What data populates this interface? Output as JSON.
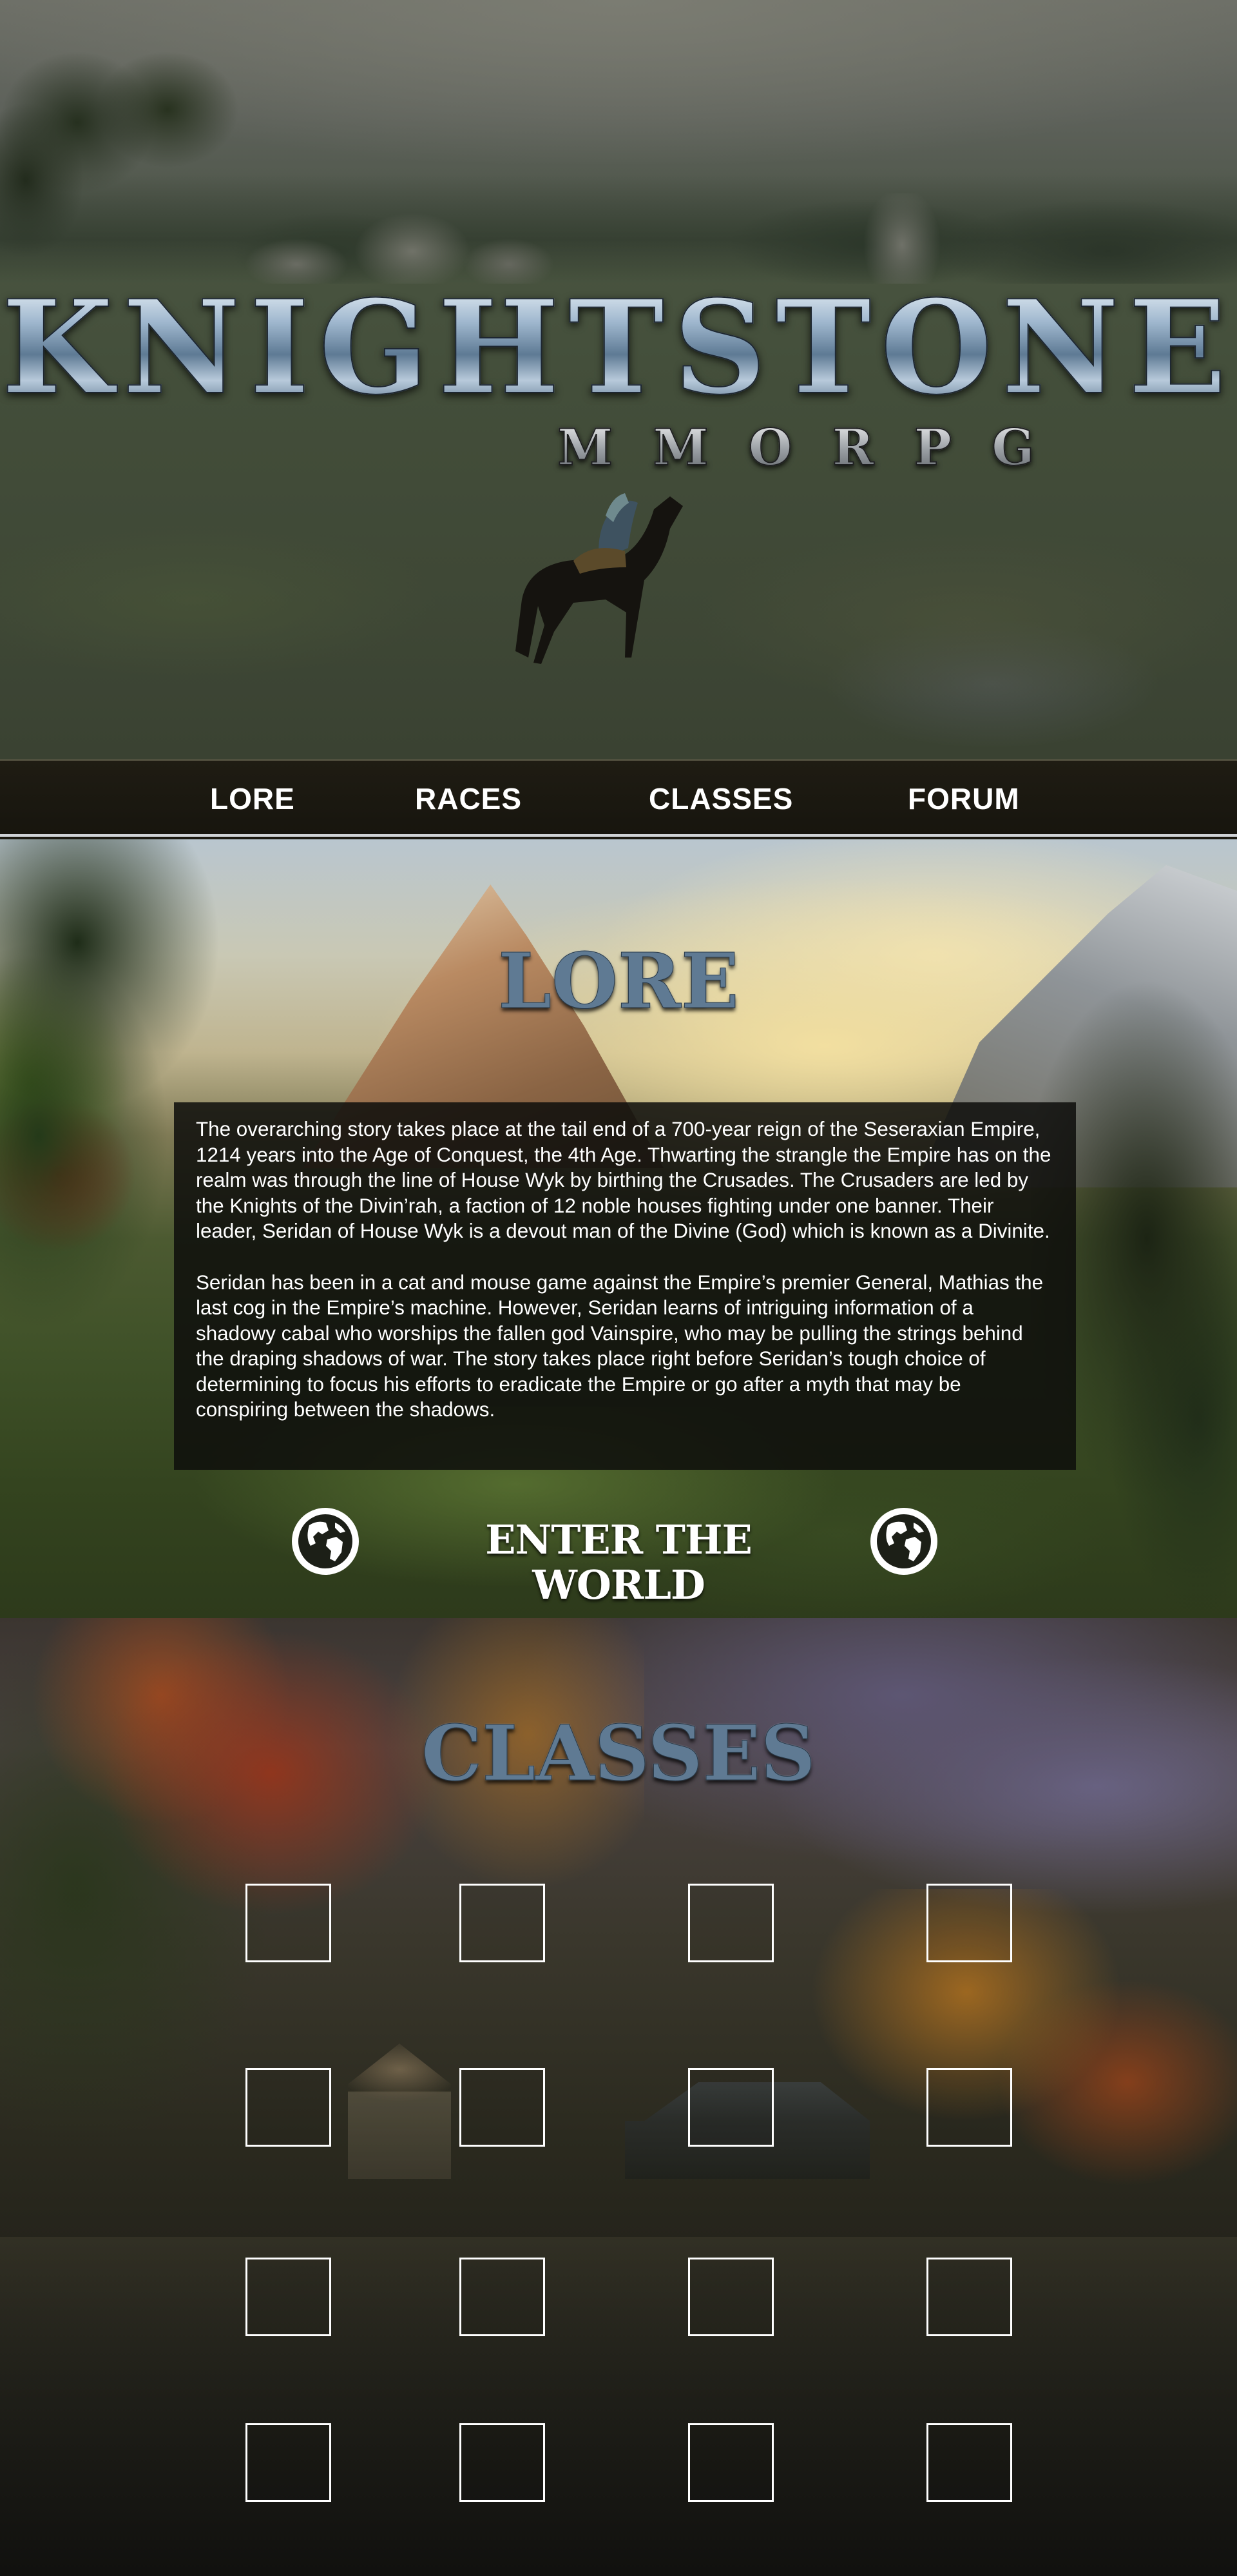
{
  "logo": {
    "title": "KNIGHTSTONE",
    "subtitle": "MMORPG"
  },
  "nav": {
    "items": [
      {
        "label": "LORE"
      },
      {
        "label": "RACES"
      },
      {
        "label": "CLASSES"
      },
      {
        "label": "FORUM"
      }
    ]
  },
  "lore": {
    "title": "LORE",
    "paragraphs": [
      "The overarching story takes place at the tail end of a 700-year reign of the Seseraxian Empire, 1214 years into the Age of Conquest, the 4th Age. Thwarting the strangle the Empire has on the realm was through the line of House Wyk by birthing the Crusades. The Crusaders are led by the Knights of the Divin’rah, a faction of 12 noble houses fighting under one banner. Their leader, Seridan of House Wyk is a devout man of the Divine (God) which is known as a Divinite.",
      "Seridan has been in a cat and mouse game against the Empire’s premier General, Mathias the last cog in the Empire’s machine. However, Seridan learns of intriguing information of a shadowy cabal who worships the fallen god Vainspire, who may be pulling the strings behind the draping shadows of war. The story takes place right before Seridan’s tough choice of determining to focus his efforts to eradicate the Empire or go after a myth that may be conspiring between the shadows."
    ],
    "cta_label": "ENTER THE WORLD",
    "cta_icon": "globe-icon"
  },
  "classes": {
    "title": "CLASSES",
    "slot_count": 16
  },
  "colors": {
    "nav_background": "#1f1c13",
    "nav_text": "#ffffff",
    "title_steel_blue": "#5f7a93",
    "lore_box_background": "#0e0e0c"
  }
}
